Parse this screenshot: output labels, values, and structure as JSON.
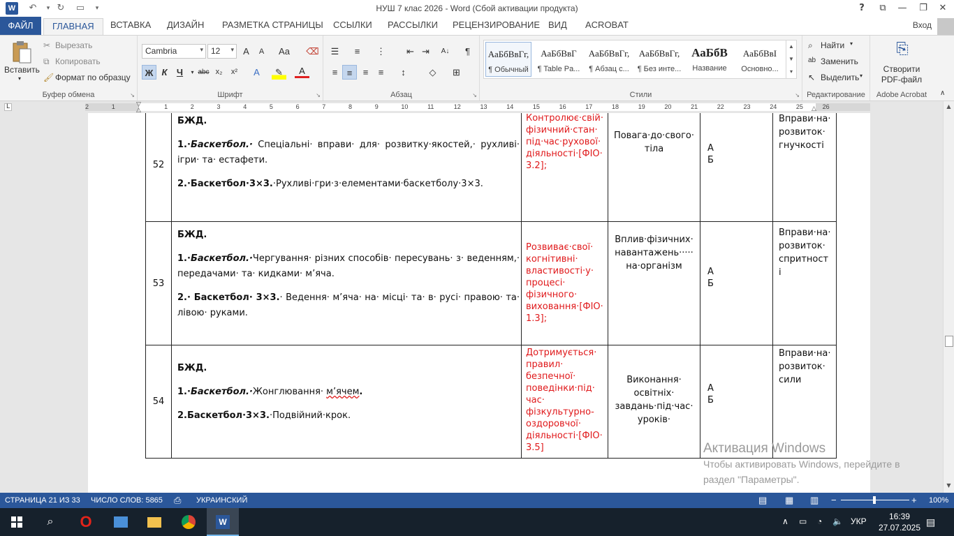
{
  "titlebar": {
    "title": "НУШ 7 клас 2026 - Word (Сбой активации продукта)",
    "help": "?",
    "icons": [
      "word-logo",
      "undo-icon",
      "redo-icon",
      "open-icon",
      "customize-icon",
      "ribbon-display-icon",
      "minimize-icon",
      "restore-icon",
      "close-icon"
    ]
  },
  "tabs": {
    "file": "ФАЙЛ",
    "items": [
      "ГЛАВНАЯ",
      "ВСТАВКА",
      "ДИЗАЙН",
      "РАЗМЕТКА СТРАНИЦЫ",
      "ССЫЛКИ",
      "РАССЫЛКИ",
      "РЕЦЕНЗИРОВАНИЕ",
      "ВИД",
      "ACROBAT"
    ],
    "signin": "Вход"
  },
  "ribbon": {
    "clipboard": {
      "label": "Буфер обмена",
      "paste": "Вставить",
      "cut": "Вырезать",
      "copy": "Копировать",
      "format_painter": "Формат по образцу"
    },
    "font": {
      "label": "Шрифт",
      "font_name": "Cambria",
      "font_size": "12",
      "grow": "A",
      "shrink": "A",
      "case": "Aa",
      "bold": "Ж",
      "italic": "К",
      "underline": "Ч",
      "strike": "abc",
      "subscript": "x₂",
      "superscript": "x²"
    },
    "paragraph": {
      "label": "Абзац",
      "pilcrow": "¶"
    },
    "styles": {
      "label": "Стили",
      "items": [
        {
          "sample": "АаБбВвГг,",
          "name": "¶ Обычный"
        },
        {
          "sample": "АаБбВвГ",
          "name": "¶ Table Pa..."
        },
        {
          "sample": "АаБбВвГг,",
          "name": "¶ Абзац с..."
        },
        {
          "sample": "АаБбВвГг,",
          "name": "¶ Без инте..."
        },
        {
          "sample": "АаБбВ",
          "name": "Название"
        },
        {
          "sample": "АаБбВвІ",
          "name": "Основно..."
        }
      ]
    },
    "editing": {
      "label": "Редактирование",
      "find": "Найти",
      "replace": "Заменить",
      "select": "Выделить"
    },
    "acrobat": {
      "label": "Adobe Acrobat",
      "create_line1": "Створити",
      "create_line2": "PDF-файл"
    }
  },
  "ruler": {
    "numbers": [
      "2",
      "1",
      "",
      "1",
      "2",
      "3",
      "4",
      "5",
      "6",
      "7",
      "8",
      "9",
      "10",
      "11",
      "12",
      "13",
      "14",
      "15",
      "16",
      "17",
      "18",
      "19",
      "20",
      "21",
      "22",
      "23",
      "24",
      "25",
      "26"
    ]
  },
  "table": {
    "rows": [
      {
        "num": "52",
        "heading": "БЖД.",
        "item1_prefix": "1.·",
        "item1_title": "Баскетбол.·",
        "item1_text": " Спеціальні· вправи· для· розвитку·якостей,· рухливі· ігри· та· естафети.",
        "item2_title": "2.·Баскетбол·3×3.",
        "item2_text": "·Рухливі·гри·з·елементами·баскетболу·3×3.",
        "outcome": "Контролює·свій· фізичний·стан· під·час·рухової· діяльності·[ФІО· 3.2];",
        "value": "Повага·до·свого· тіла",
        "mark_a": "А",
        "mark_b": "Б",
        "exercise": "Вправи·на· розвиток· гнучкості"
      },
      {
        "num": "53",
        "heading": "БЖД.",
        "item1_prefix": "1.·",
        "item1_title": "Баскетбол.·",
        "item1_text": "Чергування· різних     способів·   пересувань·   з· веденням,· передачами· та· кидками· м’яча.",
        "item2_title": "2.· Баскетбол· 3×3.",
        "item2_text": "· Ведення· м’яча· на· місці· та· в· русі· правою· та· лівою· руками.",
        "outcome": "Розвиває·свої· когнітивні· властивості·у· процесі· фізичного· виховання·[ФІО· 1.3];",
        "value": "Вплив·фізичних· навантажень····· на·організм",
        "mark_a": "А",
        "mark_b": "Б",
        "exercise": "Вправи·на· розвиток· спритност і"
      },
      {
        "num": "54",
        "heading": "БЖД.",
        "item1_prefix": "1.·",
        "item1_title": "Баскетбол.·",
        "item1_text_a": "Жонглювання· ",
        "item1_text_spell": "м’ячем",
        "item1_text_b": ".",
        "item2_title": "2.Баскетбол·3×3.",
        "item2_text": "·Подвійний·крок.",
        "outcome": "Дотримується· правил· безпечної· поведінки·під· час· фізкультурно-оздоровчої· діяльності·[ФІО· 3.5]",
        "value": "Виконання· освітніх· завдань·під·час· уроків·",
        "mark_a": "А",
        "mark_b": "Б",
        "exercise": "Вправи·на· розвиток· сили"
      }
    ]
  },
  "activation": {
    "title": "Активация Windows",
    "line1": "Чтобы активировать Windows, перейдите в",
    "line2": "раздел \"Параметры\"."
  },
  "statusbar": {
    "page": "СТРАНИЦА 21 ИЗ 33",
    "words": "ЧИСЛО СЛОВ: 5865",
    "language": "УКРАИНСКИЙ",
    "zoom": "100%",
    "zoom_minus": "−",
    "zoom_plus": "+"
  },
  "taskbar": {
    "apps": [
      "start-icon",
      "search-icon",
      "opera-icon",
      "app-icon",
      "explorer-icon",
      "chrome-icon",
      "word-icon"
    ],
    "lang": "УКР",
    "time": "16:39",
    "date": "27.07.2025"
  },
  "colors": {
    "word_blue": "#2b579a",
    "outcome_red": "#e0191b",
    "taskbar": "#16212c"
  }
}
